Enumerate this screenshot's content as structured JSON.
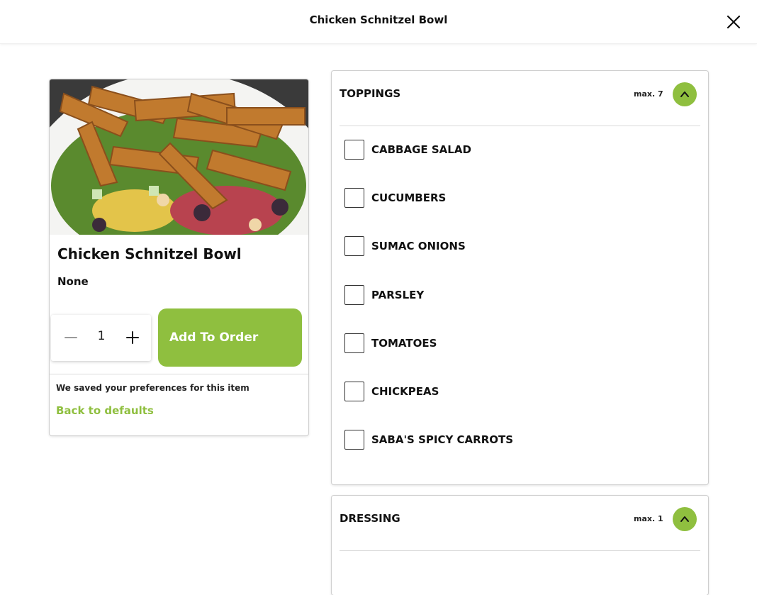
{
  "header": {
    "title": "Chicken Schnitzel Bowl"
  },
  "product": {
    "name": "Chicken Schnitzel Bowl",
    "selection_summary": "None",
    "quantity": "1",
    "add_button_label": "Add To Order",
    "preferences_note": "We saved your preferences for this item",
    "back_to_defaults_label": "Back to defaults"
  },
  "sections": [
    {
      "title": "TOPPINGS",
      "max_label": "max. 7",
      "options": [
        {
          "label": "CABBAGE SALAD",
          "checked": false
        },
        {
          "label": "CUCUMBERS",
          "checked": false
        },
        {
          "label": "SUMAC ONIONS",
          "checked": false
        },
        {
          "label": "PARSLEY",
          "checked": false
        },
        {
          "label": "TOMATOES",
          "checked": false
        },
        {
          "label": "CHICKPEAS",
          "checked": false
        },
        {
          "label": "SABA'S SPICY CARROTS",
          "checked": false
        }
      ]
    },
    {
      "title": "DRESSING",
      "max_label": "max. 1",
      "options": []
    }
  ],
  "colors": {
    "accent": "#8fbf3f",
    "text": "#111111",
    "border": "#cfcfcf"
  },
  "icons": {
    "close": "close-icon",
    "minus": "minus-icon",
    "plus": "plus-icon",
    "collapse": "chevron-up-icon"
  }
}
